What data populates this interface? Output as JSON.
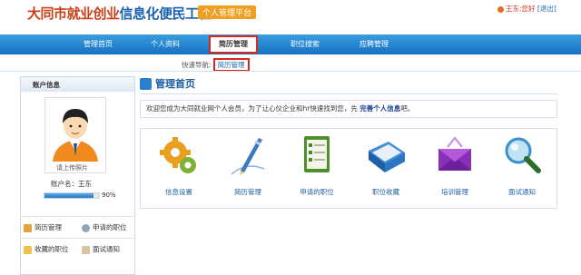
{
  "header": {
    "logo_part1": "大同市就业创业",
    "logo_part2": "信息化便民工程",
    "platform_badge": "个人管理平台",
    "user_name": "王东:您好",
    "logout": "[退出]"
  },
  "nav": {
    "items": [
      "管理首页",
      "个人资料",
      "简历管理",
      "职位搜索",
      "应聘管理"
    ],
    "active_index": 2
  },
  "quicknav": {
    "label": "快速导航:",
    "link": "简历管理"
  },
  "sidebar": {
    "title": "账户信息",
    "photo_caption": "请上传照片",
    "account_name": "账户名：王东",
    "progress_text": "90%",
    "progress_value": 0.9,
    "menu": [
      {
        "label": "简历管理",
        "icon": "resume-icon"
      },
      {
        "label": "申请的职位",
        "icon": "search-icon"
      },
      {
        "label": "收藏的职位",
        "icon": "star-icon"
      },
      {
        "label": "面试通知",
        "icon": "envelope-icon"
      }
    ]
  },
  "main": {
    "title": "管理首页",
    "welcome_text": "欢迎您成为大同就业网个人会员，为了让心仪企业和hr快速找到您，先",
    "welcome_link": "完善个人信息",
    "welcome_suffix": "吧。",
    "cards": [
      "信息设置",
      "简历管理",
      "申请的职位",
      "职位收藏",
      "培训管理",
      "面试通知"
    ]
  },
  "colors": {
    "nav_blue": "#1671c2",
    "active_border": "#d7281c",
    "title_blue": "#1d5fa3"
  }
}
